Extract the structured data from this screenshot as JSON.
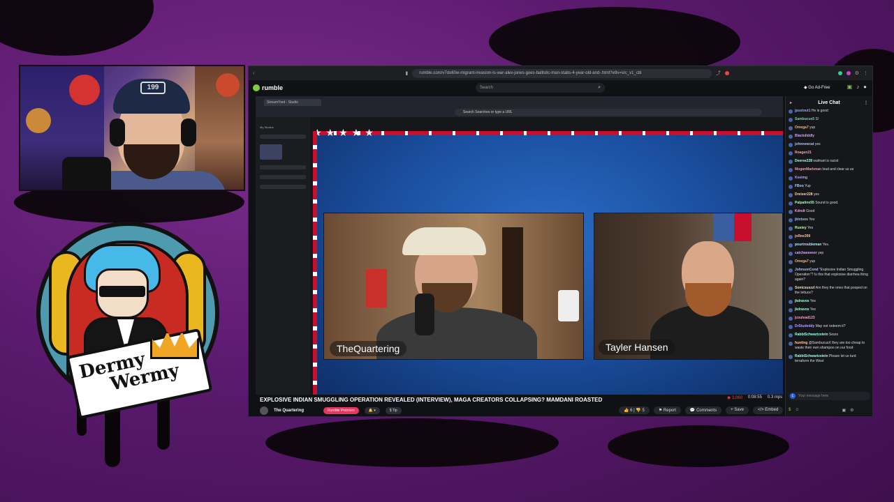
{
  "webcam": {
    "cap_logo": "199"
  },
  "logo": {
    "line1": "Dermy",
    "line2": "Wermy"
  },
  "browser": {
    "url": "rumble.com/v7do60w-migrant-invasion-is-war-alex-jones-goes-ballistic-man-stabs-4-year-old-and-.html?e9s=src_v1_cbl",
    "site_name": "rumble",
    "search_placeholder": "Search",
    "go_adfree": "Go Ad-Free"
  },
  "inner_browser": {
    "tab_label": "StreamYard - Studio",
    "url_placeholder": "Search Searches or type a URL"
  },
  "studio": {
    "item_label": "My Studios"
  },
  "video": {
    "host1": "TheQuartering",
    "host2": "Tayler Hansen",
    "title": "EXPLOSIVE INDIAN SMUGGLING OPERATION REVEALED (INTERVIEW), MAGA CREATORS COLLAPSING? MAMDANI ROASTED",
    "viewers": "3,060",
    "duration": "0:08:55",
    "bitrate": "0.3 mps"
  },
  "channel": {
    "name": "The Quartering",
    "premium": "Rumble Premium",
    "tip": "Tip"
  },
  "actions": {
    "likes": "6",
    "dislikes": "5",
    "report": "Report",
    "comments": "Comments",
    "save": "Save",
    "embed": "Embed"
  },
  "chat": {
    "title": "Live Chat",
    "input_placeholder": "Your message here",
    "input_avatar": "L",
    "messages": [
      {
        "user": "jpustout1",
        "text": "He is good",
        "color": "#9aa9ff"
      },
      {
        "user": "Sambucus5",
        "text": "S!",
        "color": "#7fd1a1"
      },
      {
        "user": "Omega7",
        "text": "yup",
        "color": "#ffb37a"
      },
      {
        "user": "Blackdiddly",
        "text": "",
        "color": "#d7a1ff"
      },
      {
        "user": "johnnewcat",
        "text": "yes",
        "color": "#a3c4ff"
      },
      {
        "user": "Roagen21",
        "text": "",
        "color": "#ffa1a1"
      },
      {
        "user": "Deeree228",
        "text": "walmart is racist",
        "color": "#a1ffd6"
      },
      {
        "user": "MoganMarkman",
        "text": "loud and clear us us",
        "color": "#ff8fb0"
      },
      {
        "user": "Keeimg",
        "text": "",
        "color": "#bda1ff"
      },
      {
        "user": "FBoo",
        "text": "Yup",
        "color": "#a1d8ff"
      },
      {
        "user": "Dreiser228",
        "text": "yes",
        "color": "#ffd6a1"
      },
      {
        "user": "Palpatine55",
        "text": "Sound is good.",
        "color": "#a1ffb8"
      },
      {
        "user": "Kdrolt",
        "text": "Good",
        "color": "#ffa1e6"
      },
      {
        "user": "jktxtsos",
        "text": "Yes",
        "color": "#a1bfff"
      },
      {
        "user": "Rustey",
        "text": "Yes",
        "color": "#c6ffa1"
      },
      {
        "user": "joRoe399",
        "text": "",
        "color": "#ffc1a1"
      },
      {
        "user": "pourtroubleman",
        "text": "Yes.",
        "color": "#a1f1ff"
      },
      {
        "user": "catchaeeeeer",
        "text": "yep",
        "color": "#e1a1ff"
      },
      {
        "user": "Omega7",
        "text": "yup",
        "color": "#ffb37a"
      },
      {
        "user": "JohnsonCond",
        "text": "\"Explosive Indian Smuggling Operation\"? Is this that explosive diarrhea thing again?",
        "color": "#a1c9ff"
      },
      {
        "user": "Sonicsuszzl",
        "text": "Are they the ones that pooped on the lettuce?",
        "color": "#ffe0a1"
      },
      {
        "user": "jkdravos",
        "text": "Yes",
        "color": "#a1ffcf"
      },
      {
        "user": "jkdravos",
        "text": "Yes",
        "color": "#a1ffcf"
      },
      {
        "user": "jcoulvad123",
        "text": "",
        "color": "#ffa1c0"
      },
      {
        "user": "DrStudeddy",
        "text": "May not redeem it?",
        "color": "#b8a1ff"
      },
      {
        "user": "RabbiSchwartzstein",
        "text": "Sears",
        "color": "#a1ffe8"
      },
      {
        "user": "hunting",
        "text": "@SambucusX they are too cheap to waste their own shampoo on our food",
        "color": "#ffcfa1"
      },
      {
        "user": "RabbiSchwartzstein",
        "text": "Please let us turd terraform the West",
        "color": "#a1ffe8"
      }
    ]
  },
  "colors": {
    "rumble_green": "#85c742",
    "premium_pink": "#e8375f",
    "live_red": "#e64545"
  }
}
